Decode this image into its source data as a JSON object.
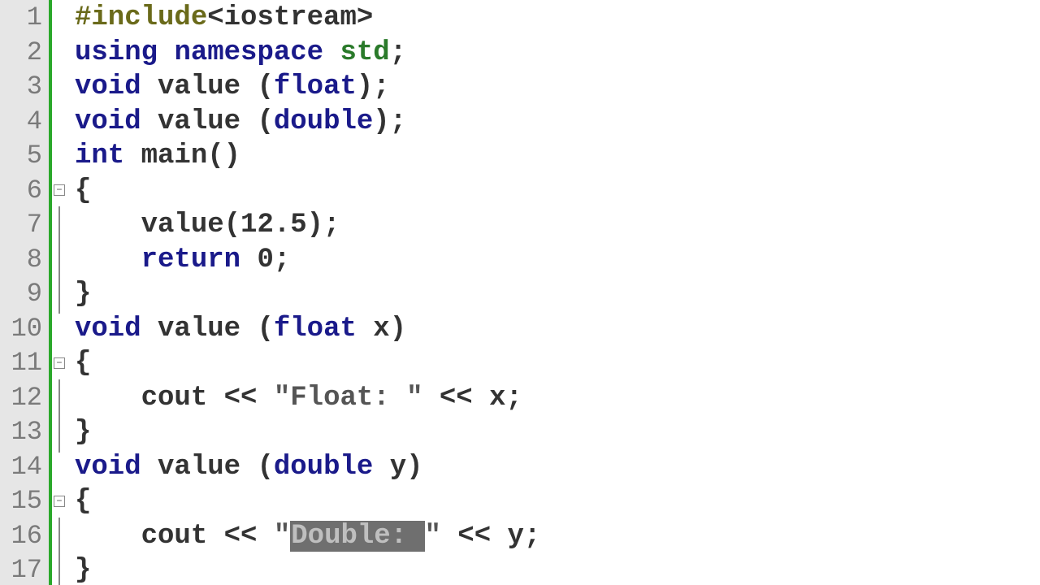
{
  "gutter": {
    "lines": [
      "1",
      "2",
      "3",
      "4",
      "5",
      "6",
      "7",
      "8",
      "9",
      "10",
      "11",
      "12",
      "13",
      "14",
      "15",
      "16",
      "17"
    ]
  },
  "code": {
    "l1_pp": "#include",
    "l1_inc": "<iostream>",
    "l2_kw1": "using",
    "l2_kw2": "namespace",
    "l2_ns": "std",
    "l2_semi": ";",
    "l3_kw": "void",
    "l3_id": "value",
    "l3_open": " (",
    "l3_ty": "float",
    "l3_close": ");",
    "l4_kw": "void",
    "l4_id": "value",
    "l4_open": " (",
    "l4_ty": "double",
    "l4_close": ");",
    "l5_kw": "int",
    "l5_id": "main",
    "l5_par": "()",
    "l6_brace": "{",
    "l7_id": "    value",
    "l7_arg": "(12.5);",
    "l8_kw": "    return",
    "l8_val": " 0;",
    "l9_brace": "}",
    "l10_kw": "void",
    "l10_id": "value",
    "l10_open": " (",
    "l10_ty": "float",
    "l10_arg": " x)",
    "l11_brace": "{",
    "l12_id": "    cout",
    "l12_op1": " << ",
    "l12_str": "\"Float: \"",
    "l12_op2": " << x;",
    "l13_brace": "}",
    "l14_kw": "void",
    "l14_id": "value",
    "l14_open": " (",
    "l14_ty": "double",
    "l14_arg": " y)",
    "l15_brace": "{",
    "l16_id": "    cout",
    "l16_op1": " << ",
    "l16_q1": "\"",
    "l16_sel": "Double: ",
    "l16_q2": "\"",
    "l16_op2": " << y;",
    "l17_brace": "}"
  }
}
